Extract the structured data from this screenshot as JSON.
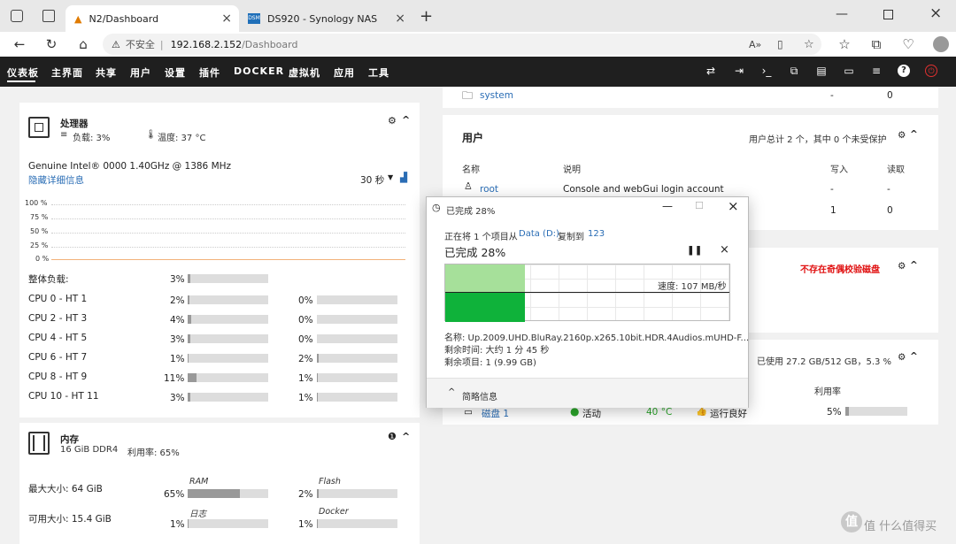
{
  "browser": {
    "tabs": [
      {
        "title": "N2/Dashboard"
      },
      {
        "title": "DS920 - Synology NAS"
      }
    ],
    "url_warning": "不安全",
    "url_host": "192.168.2.152",
    "url_path": "/Dashboard"
  },
  "topnav": {
    "items": [
      "仪表板",
      "主界面",
      "共享",
      "用户",
      "设置",
      "插件",
      "DOCKER",
      "虚拟机",
      "应用",
      "工具"
    ],
    "active_index": 0
  },
  "cpu_panel": {
    "title": "处理器",
    "load_label": "负载: 3%",
    "temp_label": "温度: 37 °C",
    "model": "Genuine Intel® 0000 1.40GHz @ 1386 MHz",
    "hide_details": "隐藏详细信息",
    "interval": "30 秒",
    "chart_ticks": [
      "100 %",
      "75 %",
      "50 %",
      "25 %",
      "0 %"
    ],
    "overall_label": "整体负载:",
    "overall_value": "3%",
    "overall_fraction": 0.03,
    "cores": [
      {
        "name": "CPU 0 - HT 1",
        "a": "2%",
        "a_f": 0.02,
        "b": "0%",
        "b_f": 0.0
      },
      {
        "name": "CPU 2 - HT 3",
        "a": "4%",
        "a_f": 0.04,
        "b": "0%",
        "b_f": 0.0
      },
      {
        "name": "CPU 4 - HT 5",
        "a": "3%",
        "a_f": 0.03,
        "b": "0%",
        "b_f": 0.0
      },
      {
        "name": "CPU 6 - HT 7",
        "a": "1%",
        "a_f": 0.01,
        "b": "2%",
        "b_f": 0.02
      },
      {
        "name": "CPU 8 - HT 9",
        "a": "11%",
        "a_f": 0.11,
        "b": "1%",
        "b_f": 0.01
      },
      {
        "name": "CPU 10 - HT 11",
        "a": "3%",
        "a_f": 0.03,
        "b": "1%",
        "b_f": 0.01
      }
    ]
  },
  "mem_panel": {
    "title": "内存",
    "spec": "16 GiB DDR4",
    "usage": "利用率: 65%",
    "max_label": "最大大小: 64 GiB",
    "avail_label": "可用大小: 15.4 GiB",
    "ram_label": "RAM",
    "ram_value": "65%",
    "ram_fraction": 0.65,
    "flash_label": "Flash",
    "flash_value": "2%",
    "flash_fraction": 0.02,
    "log_label": "日志",
    "log_value": "1%",
    "log_fraction": 0.01,
    "docker_label": "Docker",
    "docker_value": "1%",
    "docker_fraction": 0.01
  },
  "shares": {
    "row": {
      "name": "system",
      "a": "-",
      "b": "0"
    }
  },
  "users_panel": {
    "title": "用户",
    "summary": "用户总计 2 个，其中 0 个未受保护",
    "headers": {
      "name": "名称",
      "desc": "说明",
      "write": "写入",
      "read": "读取"
    },
    "rows": [
      {
        "name": "root",
        "desc": "Console and webGui login account",
        "write": "-",
        "read": "-"
      },
      {
        "name": "",
        "desc": "",
        "write": "1",
        "read": "0"
      }
    ]
  },
  "parity_panel": {
    "warning": "不存在奇偶校验磁盘"
  },
  "disk_panel": {
    "usage": "已使用 27.2 GB/512 GB，5.3 %",
    "util_header": "利用率",
    "disk_name": "磁盘 1",
    "status": "活动",
    "temp": "40 °C",
    "health": "运行良好",
    "util": "5%",
    "util_fraction": 0.05
  },
  "copy_dialog": {
    "title": "已完成 28%",
    "line_prefix": "正在将 1 个项目从",
    "source": "Data (D:)",
    "copy_to": "复制到",
    "dest": "123",
    "progress_label": "已完成 28%",
    "progress_fraction": 0.28,
    "speed": "速度: 107 MB/秒",
    "name_line": "名称: Up.2009.UHD.BluRay.2160p.x265.10bit.HDR.4Audios.mUHD-F...",
    "time_line": "剩余时间: 大约 1 分 45 秒",
    "items_line": "剩余项目: 1 (9.99 GB)",
    "details_toggle": "简略信息"
  },
  "watermark": "值 什么值得买"
}
